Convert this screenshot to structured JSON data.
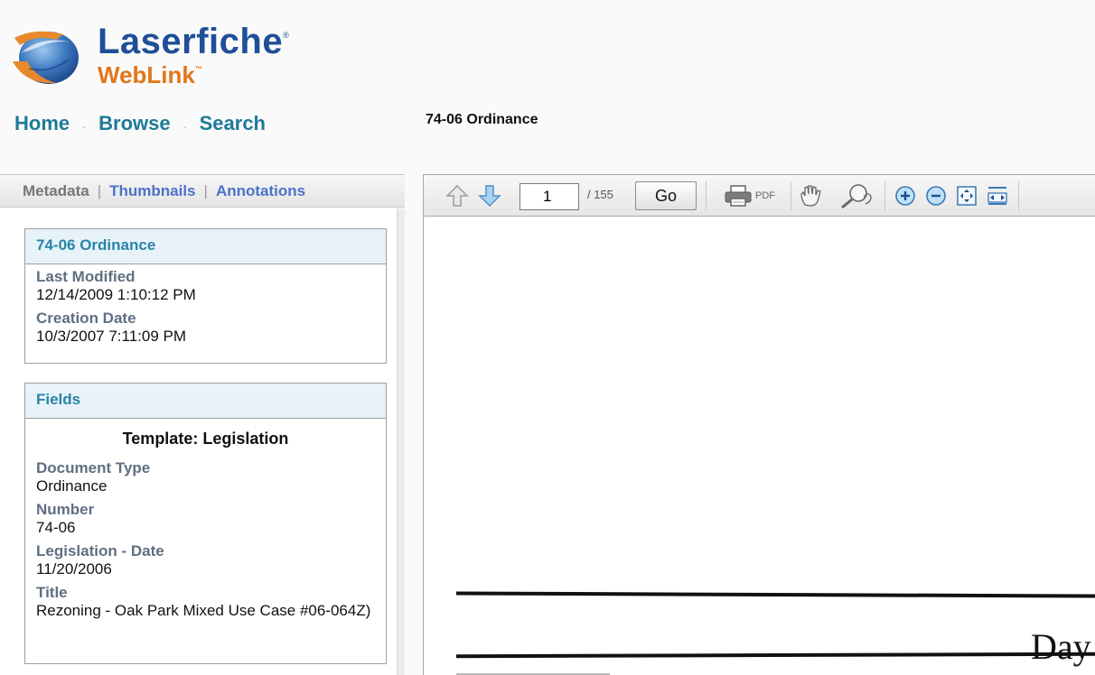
{
  "brand": {
    "name": "Laserfiche",
    "name_mark": "®",
    "product": "WebLink",
    "product_mark": "™",
    "colors": {
      "blue": "#1f4f97",
      "orange": "#e2761a",
      "link": "#1e7a98"
    }
  },
  "nav": {
    "home": "Home",
    "browse": "Browse",
    "search": "Search",
    "separator": "-"
  },
  "document_title": "74-06 Ordinance",
  "left_tabs": {
    "metadata": "Metadata",
    "thumbnails": "Thumbnails",
    "annotations": "Annotations",
    "separator": "|"
  },
  "info_box": {
    "title": "74-06 Ordinance",
    "last_modified_label": "Last Modified",
    "last_modified": "12/14/2009 1:10:12 PM",
    "creation_date_label": "Creation Date",
    "creation_date": "10/3/2007 7:11:09 PM"
  },
  "fields_box": {
    "title": "Fields",
    "template": "Template: Legislation",
    "fields": [
      {
        "label": "Document Type",
        "value": "Ordinance"
      },
      {
        "label": "Number",
        "value": "74-06"
      },
      {
        "label": "Legislation - Date",
        "value": "11/20/2006"
      },
      {
        "label": "Title",
        "value": "Rezoning - Oak Park Mixed Use Case #06-064Z)"
      }
    ]
  },
  "viewer": {
    "current_page": "1",
    "total_pages": "/ 155",
    "go_label": "Go",
    "pdf_label": "PDF",
    "page_text": "Day"
  },
  "icons": [
    "arrow-up-icon",
    "arrow-down-icon",
    "printer-icon",
    "hand-pan-icon",
    "zoom-magnifier-icon",
    "zoom-in-icon",
    "zoom-out-icon",
    "fit-page-icon",
    "fit-width-icon"
  ]
}
